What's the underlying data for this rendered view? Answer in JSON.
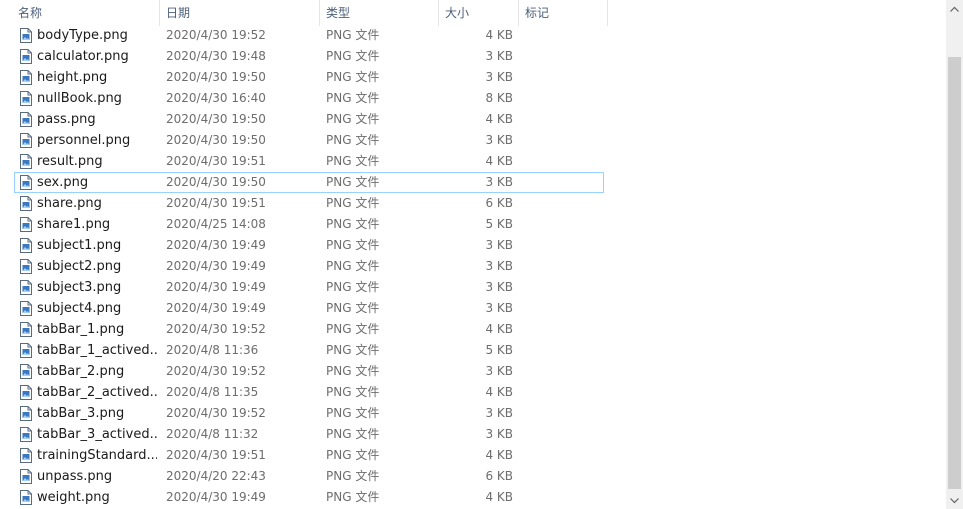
{
  "columns": {
    "name": "名称",
    "date": "日期",
    "type": "类型",
    "size": "大小",
    "tags": "标记"
  },
  "sort": {
    "column": "name",
    "icon": "chevron-up-icon"
  },
  "selected_file": "sex.png",
  "files": [
    {
      "name": "bodyType.png",
      "date": "2020/4/30 19:52",
      "type": "PNG 文件",
      "size": "4 KB"
    },
    {
      "name": "calculator.png",
      "date": "2020/4/30 19:48",
      "type": "PNG 文件",
      "size": "3 KB"
    },
    {
      "name": "height.png",
      "date": "2020/4/30 19:50",
      "type": "PNG 文件",
      "size": "3 KB"
    },
    {
      "name": "nullBook.png",
      "date": "2020/4/30 16:40",
      "type": "PNG 文件",
      "size": "8 KB"
    },
    {
      "name": "pass.png",
      "date": "2020/4/30 19:50",
      "type": "PNG 文件",
      "size": "4 KB"
    },
    {
      "name": "personnel.png",
      "date": "2020/4/30 19:50",
      "type": "PNG 文件",
      "size": "3 KB"
    },
    {
      "name": "result.png",
      "date": "2020/4/30 19:51",
      "type": "PNG 文件",
      "size": "4 KB"
    },
    {
      "name": "sex.png",
      "date": "2020/4/30 19:50",
      "type": "PNG 文件",
      "size": "3 KB"
    },
    {
      "name": "share.png",
      "date": "2020/4/30 19:51",
      "type": "PNG 文件",
      "size": "6 KB"
    },
    {
      "name": "share1.png",
      "date": "2020/4/25 14:08",
      "type": "PNG 文件",
      "size": "5 KB"
    },
    {
      "name": "subject1.png",
      "date": "2020/4/30 19:49",
      "type": "PNG 文件",
      "size": "3 KB"
    },
    {
      "name": "subject2.png",
      "date": "2020/4/30 19:49",
      "type": "PNG 文件",
      "size": "3 KB"
    },
    {
      "name": "subject3.png",
      "date": "2020/4/30 19:49",
      "type": "PNG 文件",
      "size": "3 KB"
    },
    {
      "name": "subject4.png",
      "date": "2020/4/30 19:49",
      "type": "PNG 文件",
      "size": "3 KB"
    },
    {
      "name": "tabBar_1.png",
      "date": "2020/4/30 19:52",
      "type": "PNG 文件",
      "size": "4 KB"
    },
    {
      "name": "tabBar_1_actived....",
      "date": "2020/4/8 11:36",
      "type": "PNG 文件",
      "size": "5 KB"
    },
    {
      "name": "tabBar_2.png",
      "date": "2020/4/30 19:52",
      "type": "PNG 文件",
      "size": "3 KB"
    },
    {
      "name": "tabBar_2_actived....",
      "date": "2020/4/8 11:35",
      "type": "PNG 文件",
      "size": "4 KB"
    },
    {
      "name": "tabBar_3.png",
      "date": "2020/4/30 19:52",
      "type": "PNG 文件",
      "size": "3 KB"
    },
    {
      "name": "tabBar_3_actived....",
      "date": "2020/4/8 11:32",
      "type": "PNG 文件",
      "size": "3 KB"
    },
    {
      "name": "trainingStandard....",
      "date": "2020/4/30 19:51",
      "type": "PNG 文件",
      "size": "4 KB"
    },
    {
      "name": "unpass.png",
      "date": "2020/4/20 22:43",
      "type": "PNG 文件",
      "size": "6 KB"
    },
    {
      "name": "weight.png",
      "date": "2020/4/30 19:49",
      "type": "PNG 文件",
      "size": "4 KB"
    }
  ],
  "icons": {
    "file": "png-file-icon",
    "scroll_up": "scroll-up-arrow-icon",
    "scroll_down": "scroll-down-arrow-icon"
  },
  "colors": {
    "header_text": "#4c607a",
    "selection_border": "#99d1ff",
    "secondary_text": "#6d6d6d",
    "scrollbar_track": "#f0f0f0",
    "scrollbar_thumb": "#cdcdcd"
  }
}
